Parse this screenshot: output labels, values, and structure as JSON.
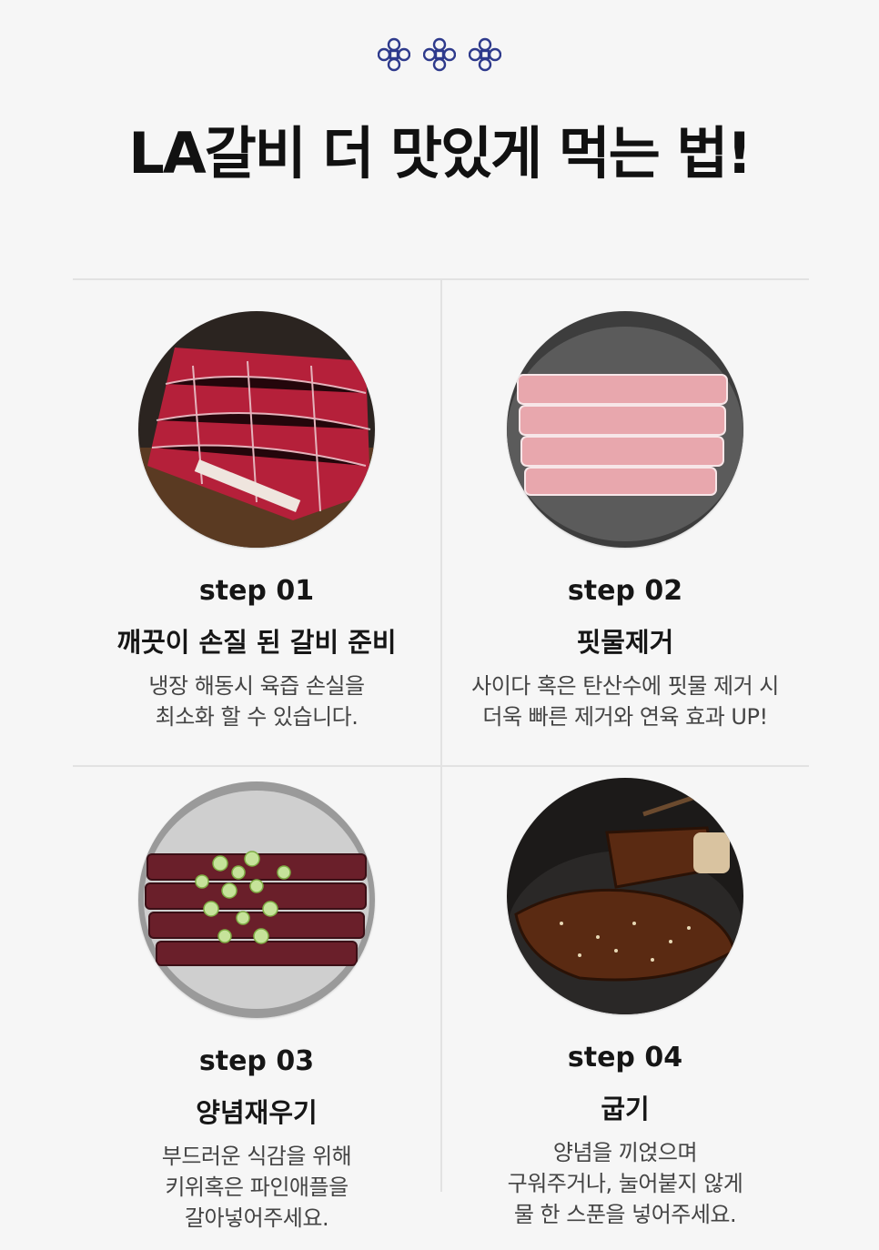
{
  "header": {
    "ornament_icon": "knot-ornament-icon",
    "ornament_color": "#2e3a8c",
    "title": "LA갈비 더 맛있게 먹는 법!"
  },
  "steps": [
    {
      "label": "step 01",
      "title": "깨끗이 손질 된 갈비 준비",
      "description": "냉장 해동시 육즙 손실을\n최소화 할 수 있습니다.",
      "image": "raw-marbled-beef-ribs-on-board"
    },
    {
      "label": "step 02",
      "title": "핏물제거",
      "description": "사이다 혹은 탄산수에 핏물 제거 시\n더욱 빠른 제거와 연육 효과 UP!",
      "image": "beef-ribs-soaking-in-pan"
    },
    {
      "label": "step 03",
      "title": "양념재우기",
      "description": "부드러운 식감을 위해\n키위혹은 파인애플을\n갈아넣어주세요.",
      "image": "marinated-ribs-with-green-onion-in-bowl"
    },
    {
      "label": "step 04",
      "title": "굽기",
      "description": "양념을 끼얹으며\n구워주거나, 눌어붙지 않게\n물 한 스푼을 넣어주세요.",
      "image": "grilled-galbi-on-plate"
    }
  ],
  "colors": {
    "background": "#f6f6f6",
    "divider": "#e2e2e2",
    "text_dark": "#161616",
    "text_body": "#444444"
  }
}
